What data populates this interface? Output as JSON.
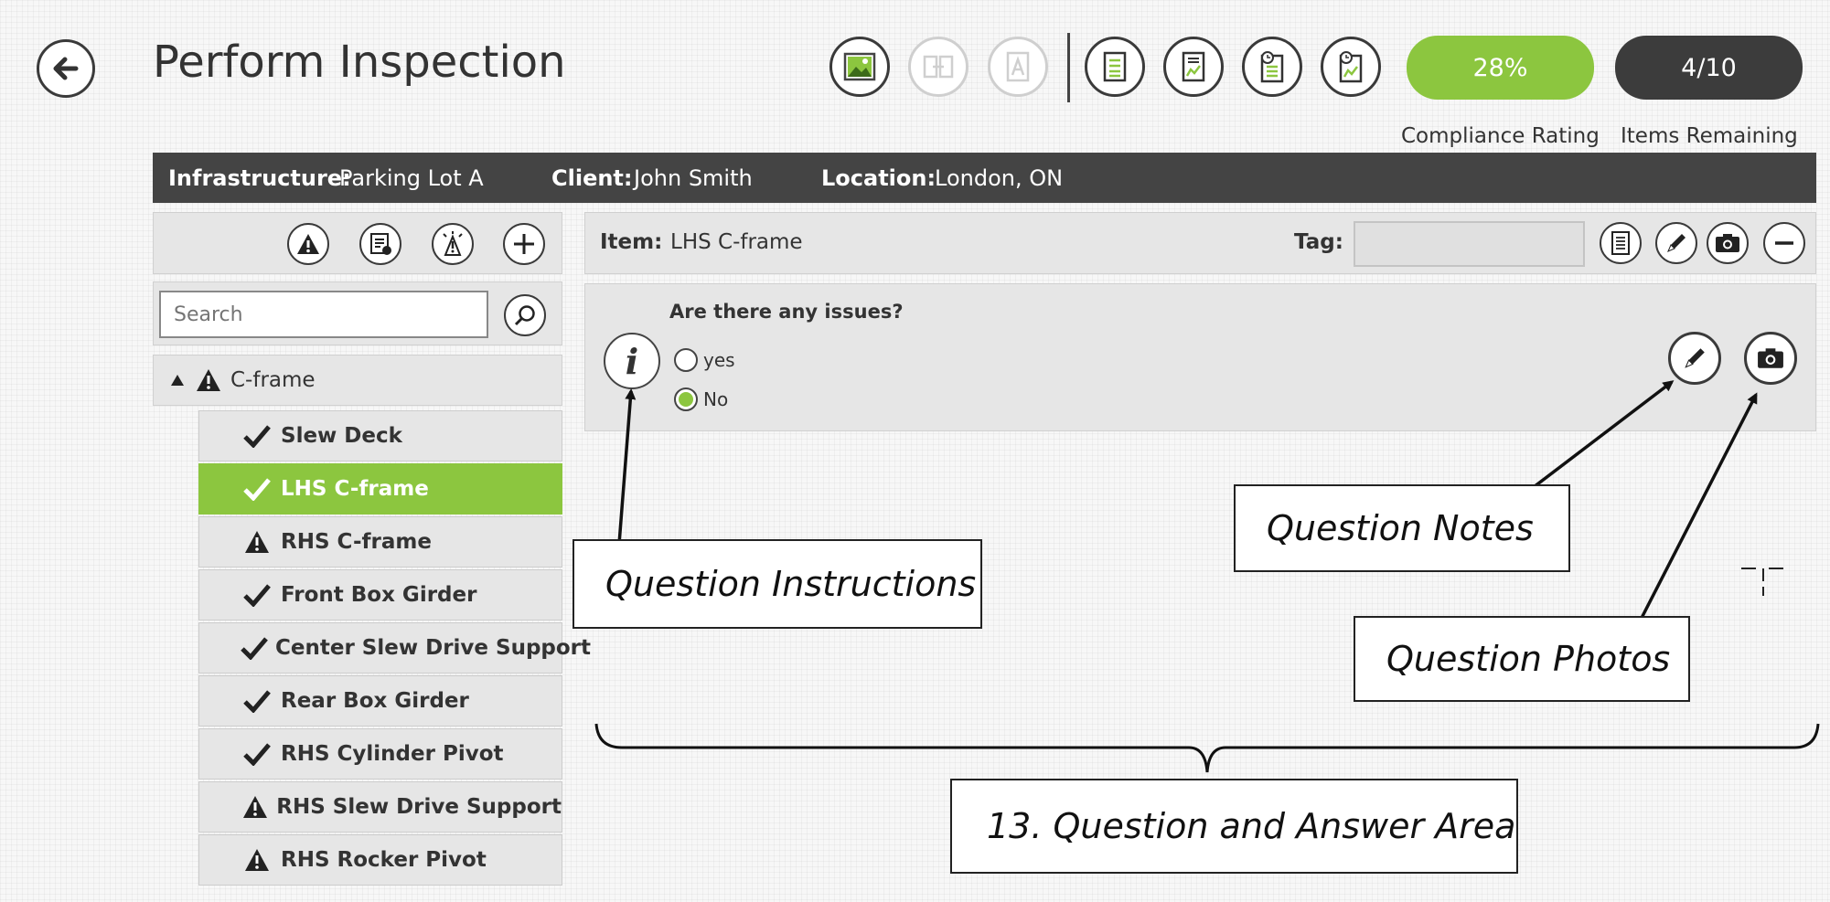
{
  "header": {
    "title": "Perform Inspection",
    "compliance": {
      "value": "28%",
      "label": "Compliance Rating",
      "color": "#8cc63f"
    },
    "remaining": {
      "value": "4/10",
      "label": "Items Remaining",
      "color": "#3c3c3c"
    },
    "toolbar_icons": [
      "image-icon",
      "compare-icon",
      "document-a-icon",
      "checklist-icon",
      "chart-report-icon",
      "timed-checklist-icon",
      "timed-chart-report-icon"
    ]
  },
  "infobar": {
    "infrastructure_label": "Infrastructure:",
    "infrastructure_value": "Parking Lot A",
    "client_label": "Client:",
    "client_value": "John Smith",
    "location_label": "Location:",
    "location_value": "London, ON"
  },
  "search": {
    "placeholder": "Search"
  },
  "tree": {
    "group_label": "C-frame",
    "items": [
      {
        "label": "Slew Deck",
        "status": "ok"
      },
      {
        "label": "LHS C-frame",
        "status": "ok",
        "selected": true
      },
      {
        "label": "RHS C-frame",
        "status": "warning"
      },
      {
        "label": "Front Box Girder",
        "status": "ok"
      },
      {
        "label": "Center Slew Drive Support",
        "status": "ok"
      },
      {
        "label": "Rear Box Girder",
        "status": "ok"
      },
      {
        "label": "RHS Cylinder Pivot",
        "status": "ok"
      },
      {
        "label": "RHS Slew Drive Support",
        "status": "warning"
      },
      {
        "label": "RHS Rocker Pivot",
        "status": "warning"
      }
    ]
  },
  "item_bar": {
    "item_label": "Item:",
    "item_value": "LHS C-frame",
    "tag_label": "Tag:",
    "tag_value": ""
  },
  "question": {
    "text": "Are there any issues?",
    "options": [
      "yes",
      "No"
    ],
    "selected": "No"
  },
  "callouts": {
    "instructions": "Question Instructions",
    "notes": "Question Notes",
    "photos": "Question Photos",
    "area": "13. Question and Answer Area"
  },
  "colors": {
    "accent": "#8cc63f",
    "dark_bar": "#444444",
    "panel": "#e6e6e6"
  }
}
